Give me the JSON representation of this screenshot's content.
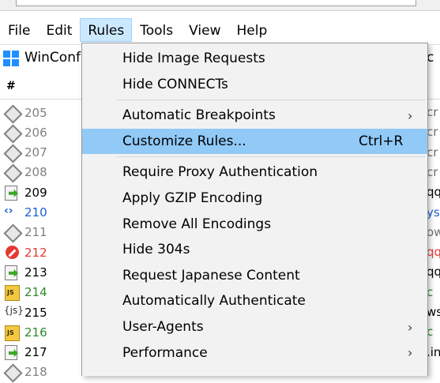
{
  "menubar": {
    "items": [
      "File",
      "Edit",
      "Rules",
      "Tools",
      "View",
      "Help"
    ],
    "active": "Rules"
  },
  "toolbar": {
    "winconfig_label": "WinConf",
    "right_fragment": "c"
  },
  "sessions": {
    "header_hash": "#",
    "rows": [
      {
        "id": "205",
        "icon": "request-diamond-icon",
        "color": "#808080",
        "right": "cr"
      },
      {
        "id": "206",
        "icon": "request-diamond-icon",
        "color": "#808080",
        "right": "cr"
      },
      {
        "id": "207",
        "icon": "request-diamond-icon",
        "color": "#808080",
        "right": "cr"
      },
      {
        "id": "208",
        "icon": "request-diamond-icon",
        "color": "#808080",
        "right": "cr"
      },
      {
        "id": "209",
        "icon": "response-arrow-icon",
        "color": "#000000",
        "right": "qq"
      },
      {
        "id": "210",
        "icon": "websocket-arrows-icon",
        "color": "#1a5fd6",
        "right": "ysi"
      },
      {
        "id": "211",
        "icon": "request-diamond-icon",
        "color": "#808080",
        "right": "ow"
      },
      {
        "id": "212",
        "icon": "blocked-icon",
        "color": "#e53935",
        "right": "qq"
      },
      {
        "id": "213",
        "icon": "response-arrow-icon",
        "color": "#000000",
        "right": "qq"
      },
      {
        "id": "214",
        "icon": "javascript-file-icon",
        "color": "#2e8b2e",
        "right": "c"
      },
      {
        "id": "215",
        "icon": "json-icon",
        "color": "#000000",
        "right": "ws"
      },
      {
        "id": "216",
        "icon": "javascript-file-icon",
        "color": "#2e8b2e",
        "right": "c"
      },
      {
        "id": "217",
        "icon": "response-arrow-icon",
        "color": "#000000",
        "right": ".in"
      },
      {
        "id": "218",
        "icon": "request-diamond-icon",
        "color": "#808080",
        "right": ""
      }
    ]
  },
  "rules_menu": {
    "items": [
      {
        "label": "Hide Image Requests",
        "shortcut": "",
        "submenu": false
      },
      {
        "label": "Hide CONNECTs",
        "shortcut": "",
        "submenu": false
      },
      {
        "separator": true
      },
      {
        "label": "Automatic Breakpoints",
        "shortcut": "",
        "submenu": true
      },
      {
        "label": "Customize Rules...",
        "shortcut": "Ctrl+R",
        "submenu": false,
        "highlighted": true
      },
      {
        "separator": true
      },
      {
        "label": "Require Proxy Authentication",
        "shortcut": "",
        "submenu": false
      },
      {
        "label": "Apply GZIP Encoding",
        "shortcut": "",
        "submenu": false
      },
      {
        "label": "Remove All Encodings",
        "shortcut": "",
        "submenu": false
      },
      {
        "label": "Hide 304s",
        "shortcut": "",
        "submenu": false
      },
      {
        "label": "Request Japanese Content",
        "shortcut": "",
        "submenu": false
      },
      {
        "label": "Automatically Authenticate",
        "shortcut": "",
        "submenu": false
      },
      {
        "label": "User-Agents",
        "shortcut": "",
        "submenu": true
      },
      {
        "label": "Performance",
        "shortcut": "",
        "submenu": true
      }
    ]
  },
  "colors": {
    "menu_active_bg": "#cce8ff",
    "menu_highlight_bg": "#91c9f7",
    "windows_blue": "#1e90ff"
  }
}
